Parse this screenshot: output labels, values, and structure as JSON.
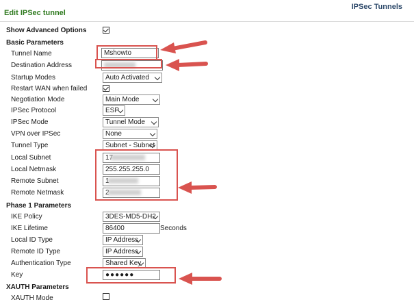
{
  "header": {
    "title": "Edit IPSec tunnel",
    "breadcrumb": "IPSec Tunnels"
  },
  "advanced": {
    "label": "Show Advanced Options",
    "checked": true
  },
  "basic": {
    "heading": "Basic Parameters",
    "tunnel_name": {
      "label": "Tunnel Name",
      "value": "Mshowto"
    },
    "destination_address": {
      "label": "Destination Address",
      "value": ""
    },
    "startup_modes": {
      "label": "Startup Modes",
      "value": "Auto Activated"
    },
    "restart_wan": {
      "label": "Restart WAN when failed",
      "checked": true
    },
    "negotiation_mode": {
      "label": "Negotiation Mode",
      "value": "Main Mode"
    },
    "ipsec_protocol": {
      "label": "IPSec Protocol",
      "value": "ESP"
    },
    "ipsec_mode": {
      "label": "IPSec Mode",
      "value": "Tunnel Mode"
    },
    "vpn_over_ipsec": {
      "label": "VPN over IPSec",
      "value": "None"
    },
    "tunnel_type": {
      "label": "Tunnel Type",
      "value": "Subnet - Subnet"
    },
    "local_subnet": {
      "label": "Local Subnet",
      "value": "17"
    },
    "local_netmask": {
      "label": "Local Netmask",
      "value": "255.255.255.0"
    },
    "remote_subnet": {
      "label": "Remote Subnet",
      "value": "1"
    },
    "remote_netmask": {
      "label": "Remote Netmask",
      "value": "2"
    }
  },
  "phase1": {
    "heading": "Phase 1 Parameters",
    "ike_policy": {
      "label": "IKE Policy",
      "value": "3DES-MD5-DH2"
    },
    "ike_lifetime": {
      "label": "IKE Lifetime",
      "value": "86400",
      "unit": "Seconds"
    },
    "local_id_type": {
      "label": "Local ID Type",
      "value": "IP Address"
    },
    "remote_id_type": {
      "label": "Remote ID Type",
      "value": "IP Address"
    },
    "auth_type": {
      "label": "Authentication Type",
      "value": "Shared Key"
    },
    "key": {
      "label": "Key",
      "value": "●●●●●●"
    }
  },
  "xauth": {
    "heading": "XAUTH Parameters",
    "mode": {
      "label": "XAUTH Mode",
      "checked": false
    }
  },
  "colors": {
    "title_green": "#2f7a1f",
    "annotation_red": "#d9534f"
  }
}
